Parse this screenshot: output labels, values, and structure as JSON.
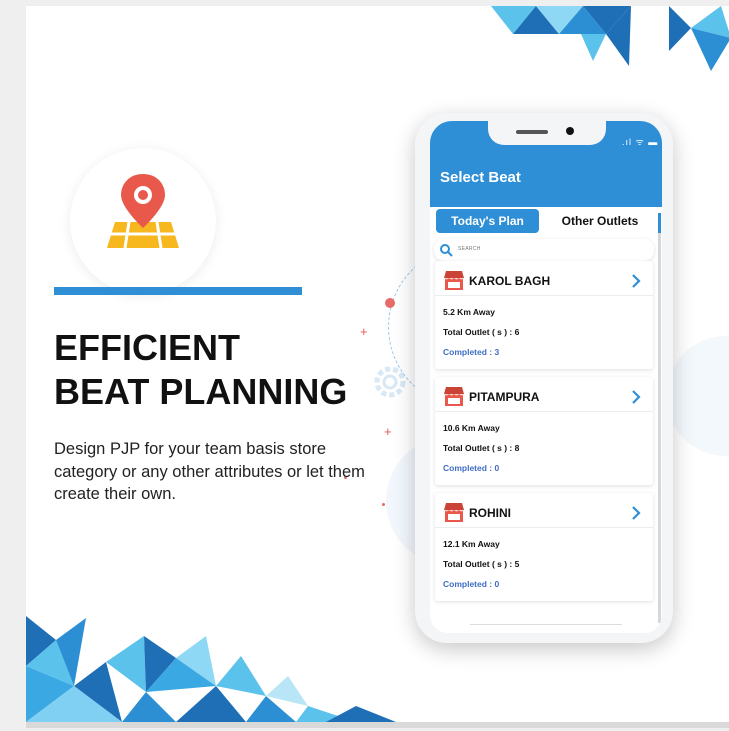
{
  "headline": {
    "line1": "EFFICIENT",
    "line2": "BEAT PLANNING"
  },
  "description": "Design PJP for your team basis store category or any other attributes or let them create their own.",
  "feature_icon": "map-location-pin-icon",
  "colors": {
    "brand_blue": "#2e8ed6",
    "pin_red": "#e9594b",
    "map_yellow": "#f6b81e",
    "completed_blue": "#3f6ec4",
    "triangle_dark": "#1f6fb6",
    "triangle_light": "#5bc2ec"
  },
  "phone": {
    "status_icons": ".ıl ᯤ ▬",
    "appbar_title": "Select Beat",
    "tabs": [
      {
        "label": "Today's Plan",
        "active": true
      },
      {
        "label": "Other Outlets",
        "active": false
      }
    ],
    "search_placeholder": "SEARCH",
    "beats": [
      {
        "name": "KAROL BAGH",
        "distance": "5.2 Km Away",
        "total_outlets": "Total Outlet ( s ) : 6",
        "completed": "Completed : 3"
      },
      {
        "name": "PITAMPURA",
        "distance": "10.6 Km Away",
        "total_outlets": "Total Outlet ( s ) : 8",
        "completed": "Completed : 0"
      },
      {
        "name": "ROHINI",
        "distance": "12.1 Km Away",
        "total_outlets": "Total Outlet ( s ) : 5",
        "completed": "Completed : 0"
      }
    ]
  }
}
